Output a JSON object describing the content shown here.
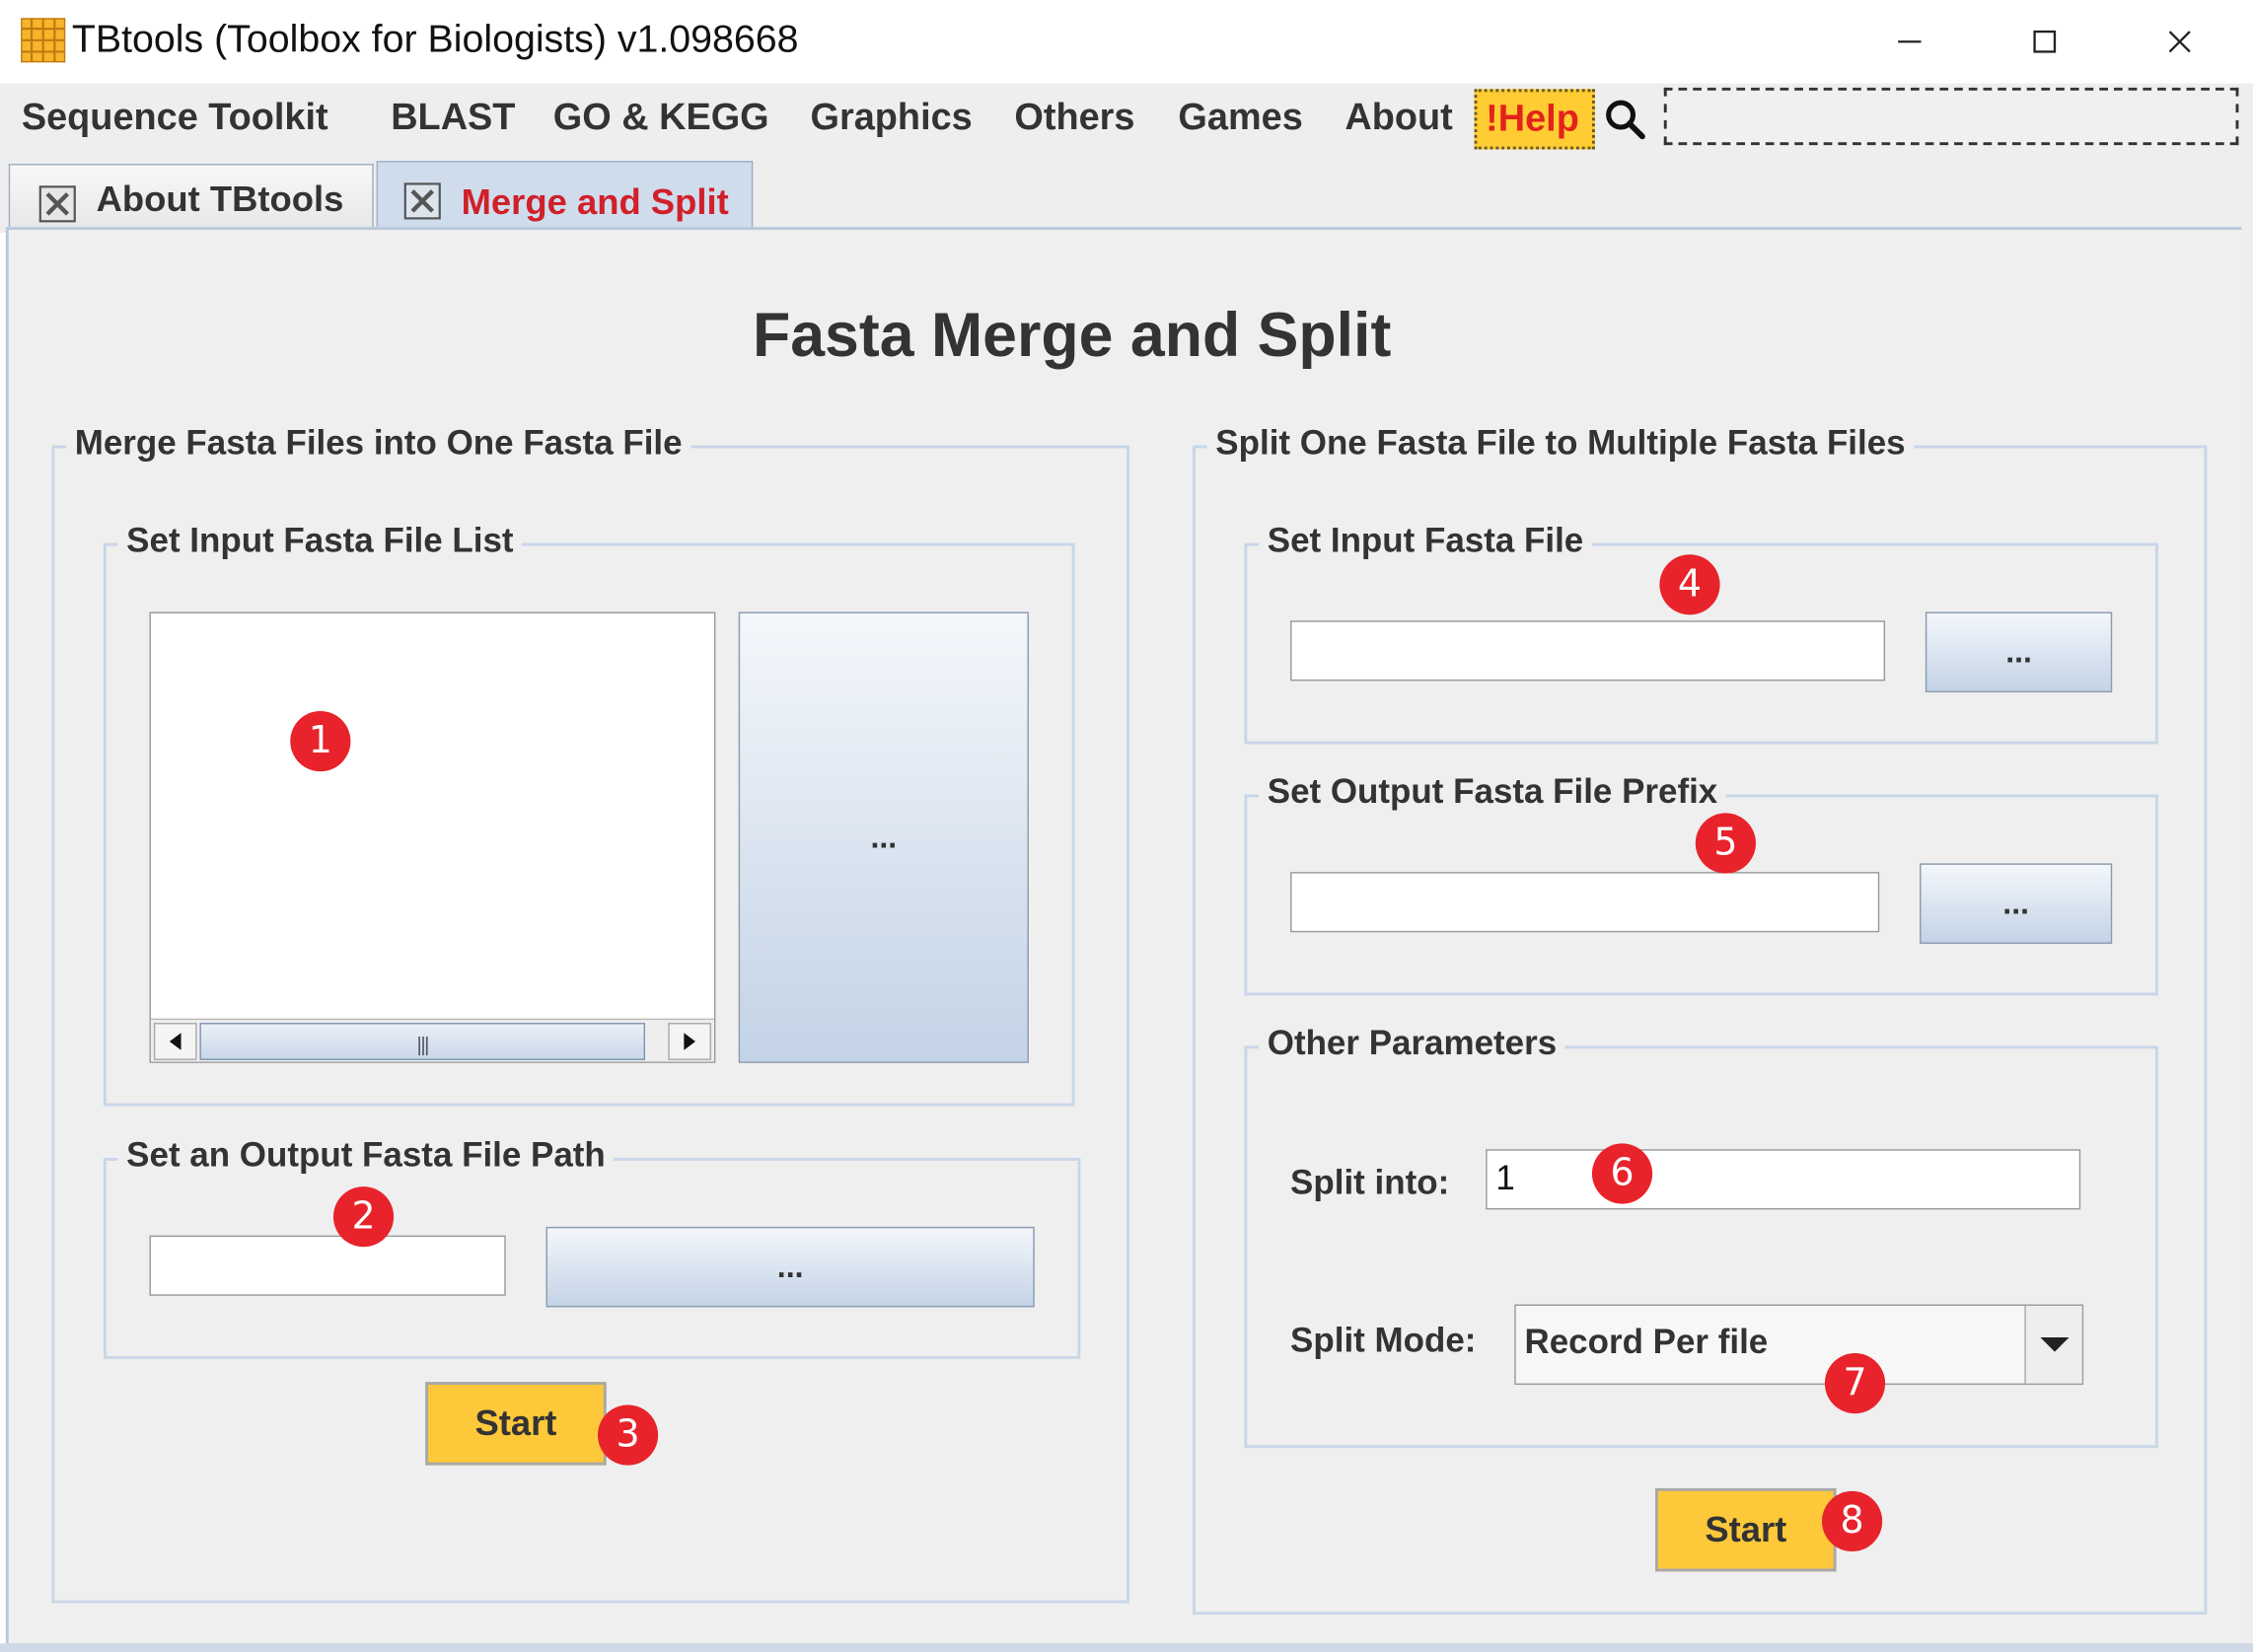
{
  "window": {
    "title": "TBtools (Toolbox for Biologists) v1.098668",
    "icon": "grid-app-icon",
    "controls": [
      "minimize-icon",
      "maximize-icon",
      "close-icon"
    ]
  },
  "menu": {
    "items": [
      "Sequence Toolkit",
      "BLAST",
      "GO & KEGG",
      "Graphics",
      "Others",
      "Games",
      "About"
    ],
    "help_label": "!Help",
    "search_value": ""
  },
  "tabs": [
    {
      "label": "About TBtools",
      "active": false
    },
    {
      "label": "Merge and Split",
      "active": true
    }
  ],
  "page": {
    "title": "Fasta Merge and Split"
  },
  "merge": {
    "group_title": "Merge Fasta Files into One Fasta File",
    "input_list": {
      "title": "Set Input Fasta File List",
      "browse_label": "..."
    },
    "output": {
      "title": "Set an Output Fasta File Path",
      "value": "",
      "browse_label": "..."
    },
    "start_label": "Start"
  },
  "split": {
    "group_title": "Split One Fasta File to Multiple Fasta Files",
    "input": {
      "title": "Set Input Fasta File",
      "value": "",
      "browse_label": "..."
    },
    "prefix": {
      "title": "Set Output Fasta File Prefix",
      "value": "",
      "browse_label": "..."
    },
    "params": {
      "title": "Other Parameters",
      "split_into_label": "Split into:",
      "split_into_value": "1",
      "split_mode_label": "Split Mode:",
      "split_mode_value": "Record Per file"
    },
    "start_label": "Start"
  },
  "markers": [
    "1",
    "2",
    "3",
    "4",
    "5",
    "6",
    "7",
    "8"
  ],
  "colors": {
    "marker": "#e8232b",
    "start_button": "#fdc83a",
    "help_bg": "#ffcc33",
    "help_text": "#e3221a",
    "active_tab_text": "#d0202a"
  }
}
